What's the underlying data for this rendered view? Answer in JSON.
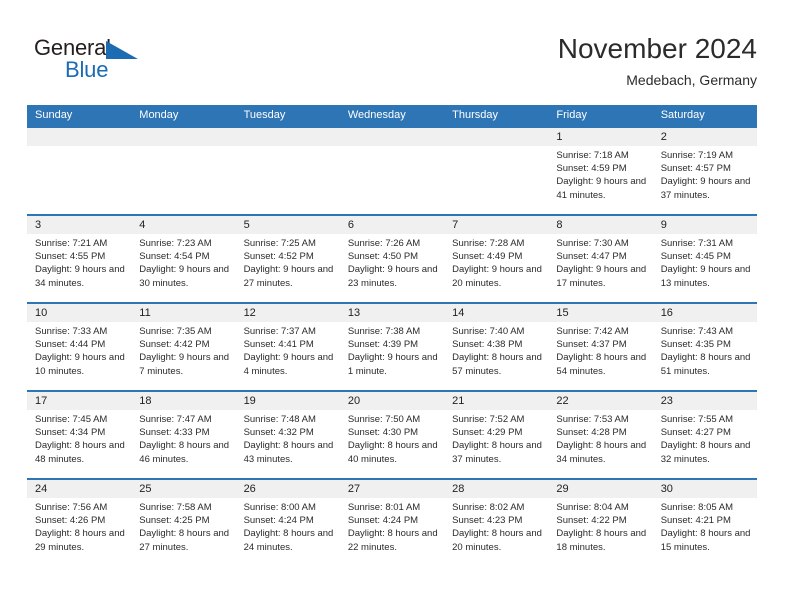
{
  "brand": {
    "word_general": "General",
    "word_blue": "Blue",
    "accent_color": "#2e75b6",
    "logo_blue": "#1b6cb3"
  },
  "header": {
    "month_title": "November 2024",
    "location": "Medebach, Germany"
  },
  "calendar": {
    "weekday_headers": [
      "Sunday",
      "Monday",
      "Tuesday",
      "Wednesday",
      "Thursday",
      "Friday",
      "Saturday"
    ],
    "weeks": [
      [
        {
          "day": "",
          "sunrise": "",
          "sunset": "",
          "daylight": "",
          "empty": true
        },
        {
          "day": "",
          "sunrise": "",
          "sunset": "",
          "daylight": "",
          "empty": true
        },
        {
          "day": "",
          "sunrise": "",
          "sunset": "",
          "daylight": "",
          "empty": true
        },
        {
          "day": "",
          "sunrise": "",
          "sunset": "",
          "daylight": "",
          "empty": true
        },
        {
          "day": "",
          "sunrise": "",
          "sunset": "",
          "daylight": "",
          "empty": true
        },
        {
          "day": "1",
          "sunrise": "Sunrise: 7:18 AM",
          "sunset": "Sunset: 4:59 PM",
          "daylight": "Daylight: 9 hours and 41 minutes.",
          "empty": false
        },
        {
          "day": "2",
          "sunrise": "Sunrise: 7:19 AM",
          "sunset": "Sunset: 4:57 PM",
          "daylight": "Daylight: 9 hours and 37 minutes.",
          "empty": false
        }
      ],
      [
        {
          "day": "3",
          "sunrise": "Sunrise: 7:21 AM",
          "sunset": "Sunset: 4:55 PM",
          "daylight": "Daylight: 9 hours and 34 minutes.",
          "empty": false
        },
        {
          "day": "4",
          "sunrise": "Sunrise: 7:23 AM",
          "sunset": "Sunset: 4:54 PM",
          "daylight": "Daylight: 9 hours and 30 minutes.",
          "empty": false
        },
        {
          "day": "5",
          "sunrise": "Sunrise: 7:25 AM",
          "sunset": "Sunset: 4:52 PM",
          "daylight": "Daylight: 9 hours and 27 minutes.",
          "empty": false
        },
        {
          "day": "6",
          "sunrise": "Sunrise: 7:26 AM",
          "sunset": "Sunset: 4:50 PM",
          "daylight": "Daylight: 9 hours and 23 minutes.",
          "empty": false
        },
        {
          "day": "7",
          "sunrise": "Sunrise: 7:28 AM",
          "sunset": "Sunset: 4:49 PM",
          "daylight": "Daylight: 9 hours and 20 minutes.",
          "empty": false
        },
        {
          "day": "8",
          "sunrise": "Sunrise: 7:30 AM",
          "sunset": "Sunset: 4:47 PM",
          "daylight": "Daylight: 9 hours and 17 minutes.",
          "empty": false
        },
        {
          "day": "9",
          "sunrise": "Sunrise: 7:31 AM",
          "sunset": "Sunset: 4:45 PM",
          "daylight": "Daylight: 9 hours and 13 minutes.",
          "empty": false
        }
      ],
      [
        {
          "day": "10",
          "sunrise": "Sunrise: 7:33 AM",
          "sunset": "Sunset: 4:44 PM",
          "daylight": "Daylight: 9 hours and 10 minutes.",
          "empty": false
        },
        {
          "day": "11",
          "sunrise": "Sunrise: 7:35 AM",
          "sunset": "Sunset: 4:42 PM",
          "daylight": "Daylight: 9 hours and 7 minutes.",
          "empty": false
        },
        {
          "day": "12",
          "sunrise": "Sunrise: 7:37 AM",
          "sunset": "Sunset: 4:41 PM",
          "daylight": "Daylight: 9 hours and 4 minutes.",
          "empty": false
        },
        {
          "day": "13",
          "sunrise": "Sunrise: 7:38 AM",
          "sunset": "Sunset: 4:39 PM",
          "daylight": "Daylight: 9 hours and 1 minute.",
          "empty": false
        },
        {
          "day": "14",
          "sunrise": "Sunrise: 7:40 AM",
          "sunset": "Sunset: 4:38 PM",
          "daylight": "Daylight: 8 hours and 57 minutes.",
          "empty": false
        },
        {
          "day": "15",
          "sunrise": "Sunrise: 7:42 AM",
          "sunset": "Sunset: 4:37 PM",
          "daylight": "Daylight: 8 hours and 54 minutes.",
          "empty": false
        },
        {
          "day": "16",
          "sunrise": "Sunrise: 7:43 AM",
          "sunset": "Sunset: 4:35 PM",
          "daylight": "Daylight: 8 hours and 51 minutes.",
          "empty": false
        }
      ],
      [
        {
          "day": "17",
          "sunrise": "Sunrise: 7:45 AM",
          "sunset": "Sunset: 4:34 PM",
          "daylight": "Daylight: 8 hours and 48 minutes.",
          "empty": false
        },
        {
          "day": "18",
          "sunrise": "Sunrise: 7:47 AM",
          "sunset": "Sunset: 4:33 PM",
          "daylight": "Daylight: 8 hours and 46 minutes.",
          "empty": false
        },
        {
          "day": "19",
          "sunrise": "Sunrise: 7:48 AM",
          "sunset": "Sunset: 4:32 PM",
          "daylight": "Daylight: 8 hours and 43 minutes.",
          "empty": false
        },
        {
          "day": "20",
          "sunrise": "Sunrise: 7:50 AM",
          "sunset": "Sunset: 4:30 PM",
          "daylight": "Daylight: 8 hours and 40 minutes.",
          "empty": false
        },
        {
          "day": "21",
          "sunrise": "Sunrise: 7:52 AM",
          "sunset": "Sunset: 4:29 PM",
          "daylight": "Daylight: 8 hours and 37 minutes.",
          "empty": false
        },
        {
          "day": "22",
          "sunrise": "Sunrise: 7:53 AM",
          "sunset": "Sunset: 4:28 PM",
          "daylight": "Daylight: 8 hours and 34 minutes.",
          "empty": false
        },
        {
          "day": "23",
          "sunrise": "Sunrise: 7:55 AM",
          "sunset": "Sunset: 4:27 PM",
          "daylight": "Daylight: 8 hours and 32 minutes.",
          "empty": false
        }
      ],
      [
        {
          "day": "24",
          "sunrise": "Sunrise: 7:56 AM",
          "sunset": "Sunset: 4:26 PM",
          "daylight": "Daylight: 8 hours and 29 minutes.",
          "empty": false
        },
        {
          "day": "25",
          "sunrise": "Sunrise: 7:58 AM",
          "sunset": "Sunset: 4:25 PM",
          "daylight": "Daylight: 8 hours and 27 minutes.",
          "empty": false
        },
        {
          "day": "26",
          "sunrise": "Sunrise: 8:00 AM",
          "sunset": "Sunset: 4:24 PM",
          "daylight": "Daylight: 8 hours and 24 minutes.",
          "empty": false
        },
        {
          "day": "27",
          "sunrise": "Sunrise: 8:01 AM",
          "sunset": "Sunset: 4:24 PM",
          "daylight": "Daylight: 8 hours and 22 minutes.",
          "empty": false
        },
        {
          "day": "28",
          "sunrise": "Sunrise: 8:02 AM",
          "sunset": "Sunset: 4:23 PM",
          "daylight": "Daylight: 8 hours and 20 minutes.",
          "empty": false
        },
        {
          "day": "29",
          "sunrise": "Sunrise: 8:04 AM",
          "sunset": "Sunset: 4:22 PM",
          "daylight": "Daylight: 8 hours and 18 minutes.",
          "empty": false
        },
        {
          "day": "30",
          "sunrise": "Sunrise: 8:05 AM",
          "sunset": "Sunset: 4:21 PM",
          "daylight": "Daylight: 8 hours and 15 minutes.",
          "empty": false
        }
      ]
    ]
  }
}
